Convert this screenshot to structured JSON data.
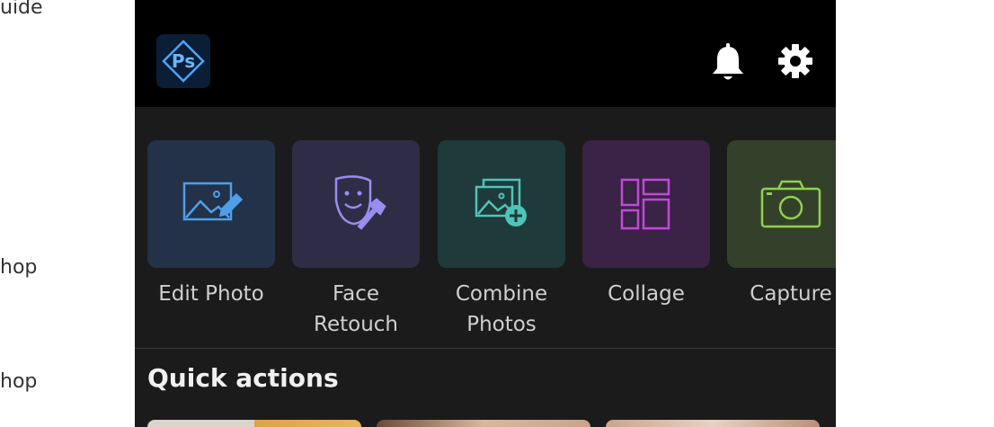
{
  "background": {
    "fragments": [
      "uide",
      "hop",
      "hop"
    ]
  },
  "header": {
    "app_icon": "photoshop-express-logo",
    "logo_text": "Ps",
    "notification_icon": "bell-icon",
    "settings_icon": "gear-icon"
  },
  "tiles": [
    {
      "label": "Edit Photo",
      "icon": "edit-photo-icon",
      "bg": "#233248",
      "stroke": "#4f9fe8"
    },
    {
      "label": "Face\nRetouch",
      "icon": "face-retouch-icon",
      "bg": "#2e2d45",
      "stroke": "#9a8df0"
    },
    {
      "label": "Combine\nPhotos",
      "icon": "combine-photos-icon",
      "bg": "#1e3a3a",
      "stroke": "#4fc3b8"
    },
    {
      "label": "Collage",
      "icon": "collage-icon",
      "bg": "#3a2346",
      "stroke": "#c04bd8"
    },
    {
      "label": "Capture",
      "icon": "camera-icon",
      "bg": "#34412a",
      "stroke": "#8fd14f"
    }
  ],
  "quick_actions": {
    "title": "Quick actions"
  },
  "colors": {
    "topbar": "#000000",
    "panel": "#1b1b1b",
    "text": "#cfcfcf",
    "accent": "#4f9fe8"
  }
}
